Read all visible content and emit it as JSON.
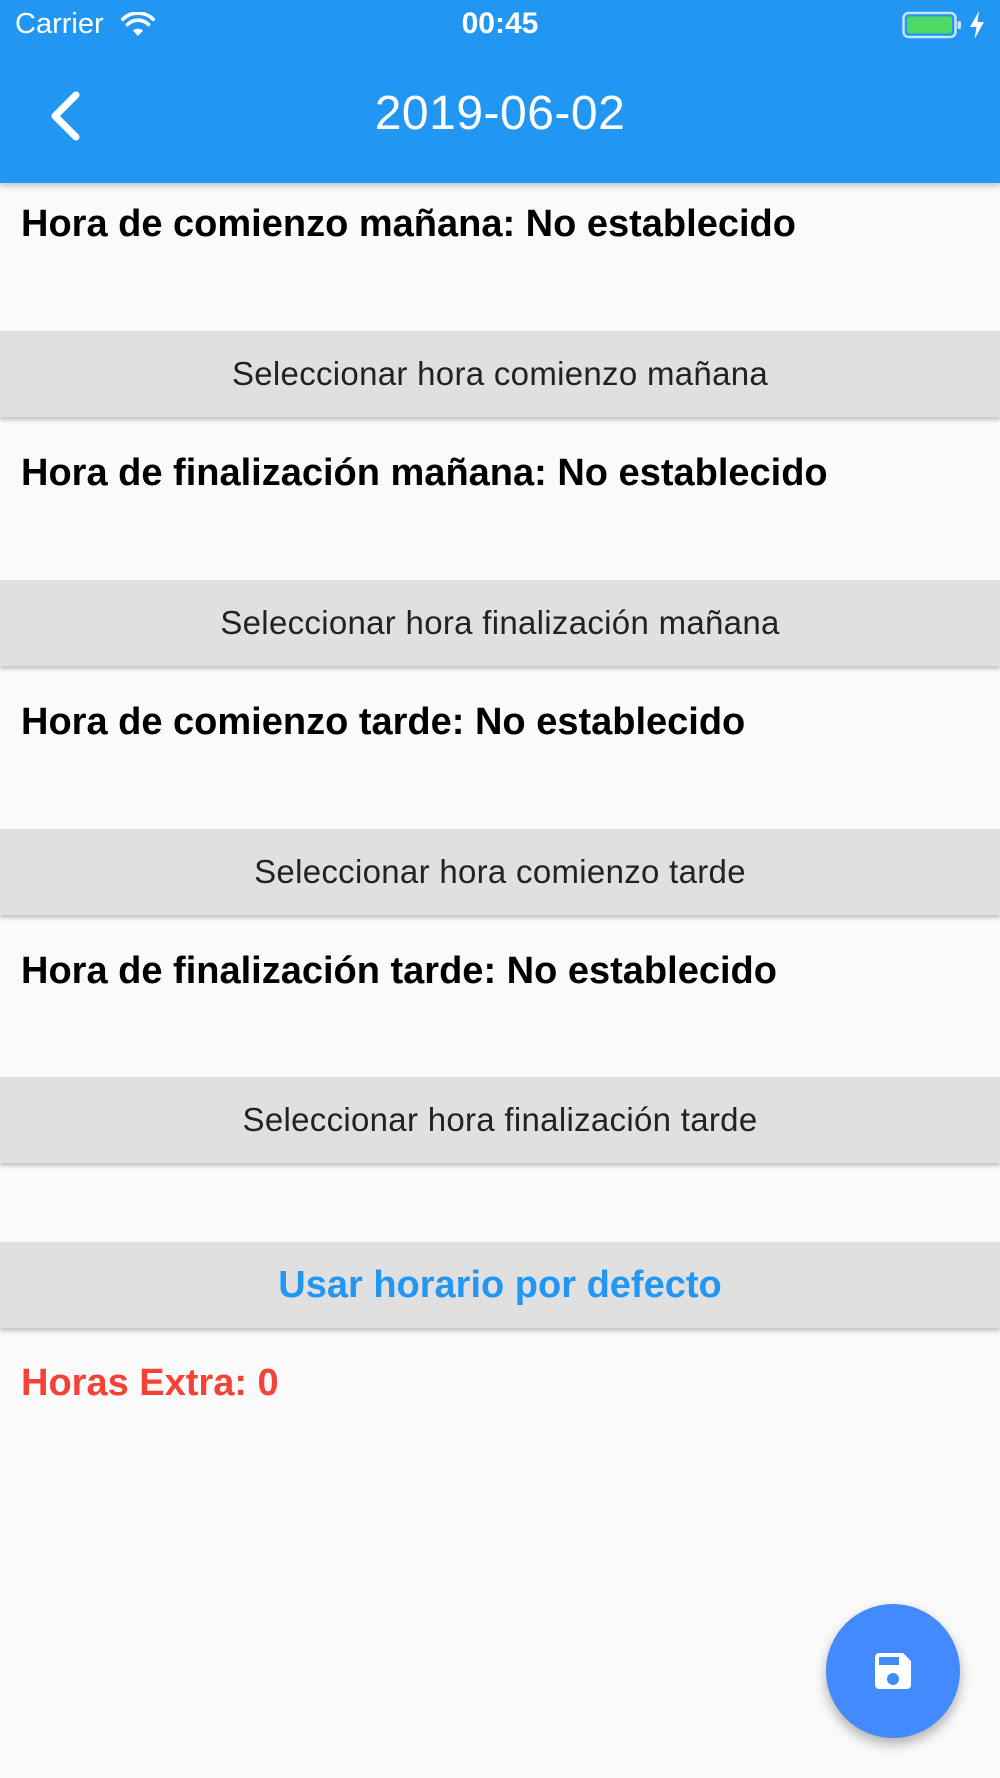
{
  "status_bar": {
    "carrier": "Carrier",
    "time": "00:45",
    "icons": [
      "wifi-icon",
      "battery-icon",
      "charging-icon"
    ]
  },
  "app_bar": {
    "title": "2019-06-02",
    "back_icon": "chevron-left-icon",
    "color": "#2196f3"
  },
  "schedule": {
    "morning_start_label": "Hora de comienzo mañana: No establecido",
    "morning_start_button": "Seleccionar hora comienzo mañana",
    "morning_end_label": "Hora de finalización mañana: No establecido",
    "morning_end_button": "Seleccionar hora finalización mañana",
    "afternoon_start_label": "Hora de comienzo tarde: No establecido",
    "afternoon_start_button": "Seleccionar hora comienzo tarde",
    "afternoon_end_label": "Hora de finalización tarde: No establecido",
    "afternoon_end_button": "Seleccionar hora finalización tarde"
  },
  "default_button": {
    "label": "Usar horario por defecto",
    "color": "#2196f3"
  },
  "extra_hours": {
    "text": "Horas Extra: 0",
    "color": "#f44336"
  },
  "fab": {
    "icon": "save-icon",
    "color": "#448aff"
  }
}
